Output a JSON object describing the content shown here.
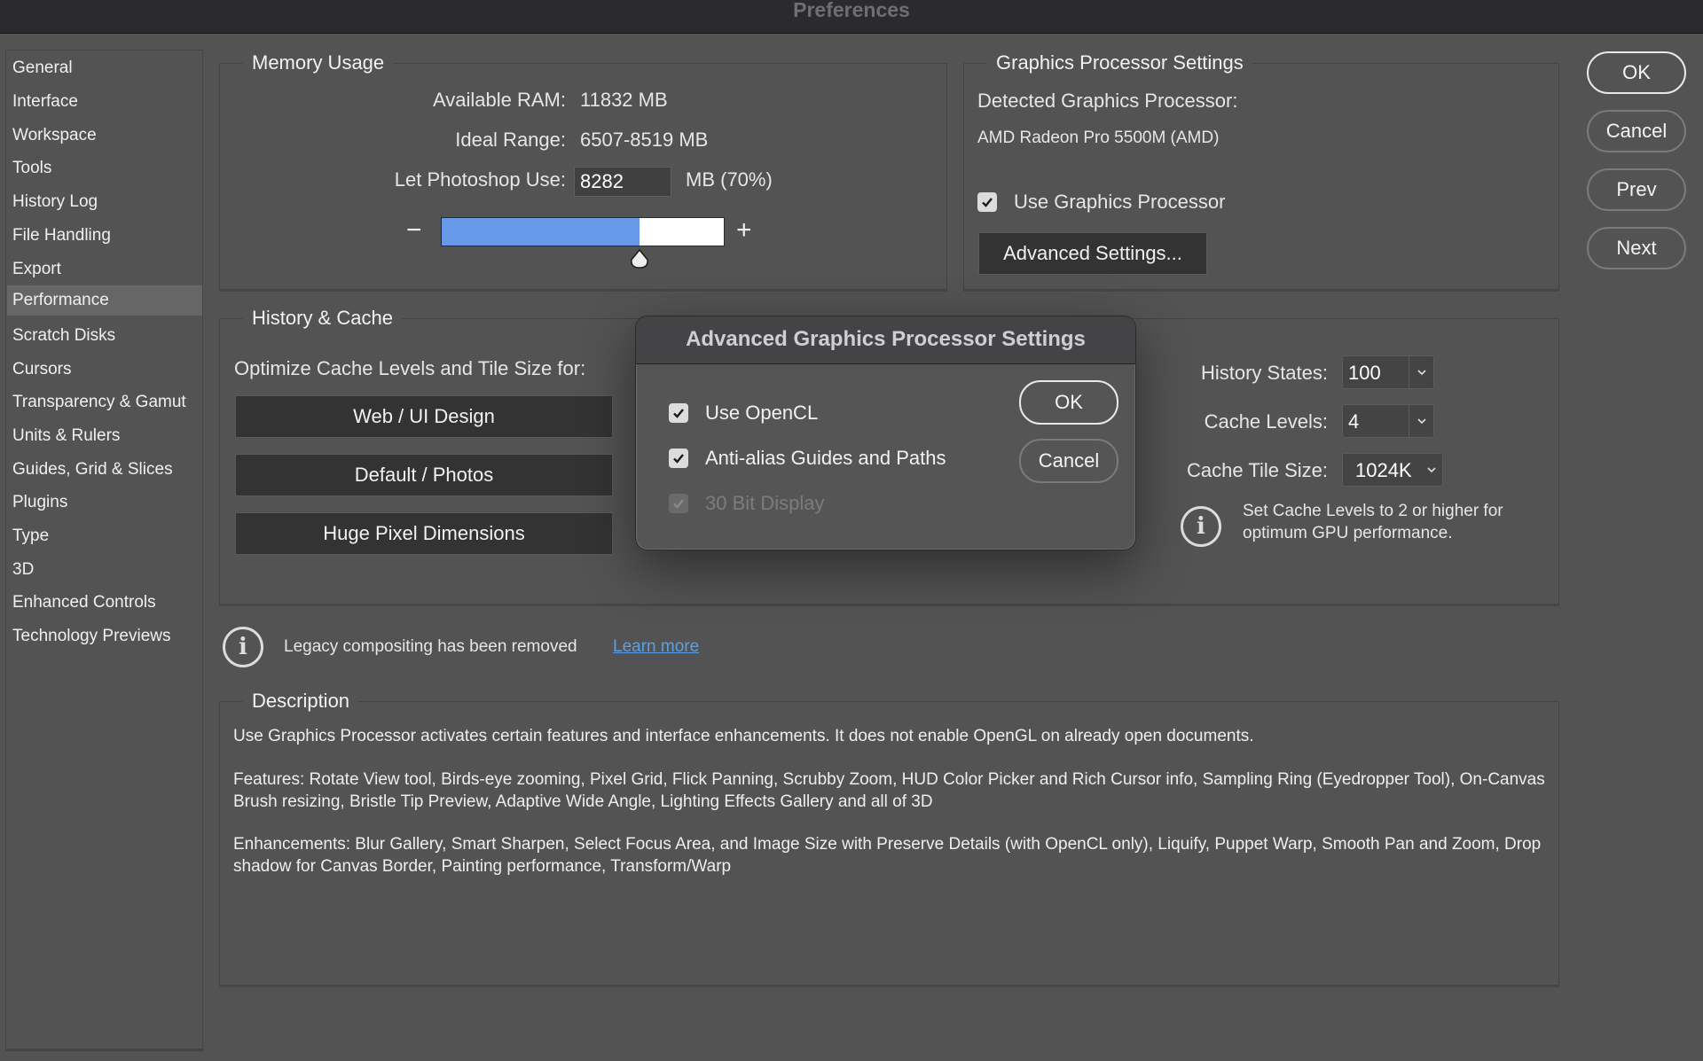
{
  "window": {
    "title": "Preferences"
  },
  "sidebar": {
    "items": [
      {
        "label": "General",
        "active": false
      },
      {
        "label": "Interface",
        "active": false
      },
      {
        "label": "Workspace",
        "active": false
      },
      {
        "label": "Tools",
        "active": false
      },
      {
        "label": "History Log",
        "active": false
      },
      {
        "label": "File Handling",
        "active": false
      },
      {
        "label": "Export",
        "active": false
      },
      {
        "label": "Performance",
        "active": true
      },
      {
        "label": "Scratch Disks",
        "active": false
      },
      {
        "label": "Cursors",
        "active": false
      },
      {
        "label": "Transparency & Gamut",
        "active": false
      },
      {
        "label": "Units & Rulers",
        "active": false
      },
      {
        "label": "Guides, Grid & Slices",
        "active": false
      },
      {
        "label": "Plugins",
        "active": false
      },
      {
        "label": "Type",
        "active": false
      },
      {
        "label": "3D",
        "active": false
      },
      {
        "label": "Enhanced Controls",
        "active": false
      },
      {
        "label": "Technology Previews",
        "active": false
      }
    ]
  },
  "memory": {
    "legend": "Memory Usage",
    "available_label": "Available RAM:",
    "available_value": "11832 MB",
    "ideal_label": "Ideal Range:",
    "ideal_value": "6507-8519 MB",
    "use_label": "Let Photoshop Use:",
    "use_value": "8282",
    "use_unit": "MB (70%)",
    "slider_percent": 70,
    "minus": "−",
    "plus": "+"
  },
  "gpu": {
    "legend": "Graphics Processor Settings",
    "detected_label": "Detected Graphics Processor:",
    "detected_value": "AMD Radeon Pro 5500M (AMD)",
    "use_gpu_label": "Use Graphics Processor",
    "use_gpu_checked": true,
    "advanced_button": "Advanced Settings..."
  },
  "history": {
    "legend": "History & Cache",
    "optimize_label": "Optimize Cache Levels and Tile Size for:",
    "presets": [
      "Web / UI Design",
      "Default / Photos",
      "Huge Pixel Dimensions"
    ],
    "history_states_label": "History States:",
    "history_states_value": "100",
    "cache_levels_label": "Cache Levels:",
    "cache_levels_value": "4",
    "cache_tile_label": "Cache Tile Size:",
    "cache_tile_value": "1024K",
    "gpu_tip": "Set Cache Levels to 2 or higher for optimum GPU performance."
  },
  "notice": {
    "text": "Legacy compositing has been removed",
    "link": "Learn more",
    "link_color": "#5aa0e6"
  },
  "description": {
    "legend": "Description",
    "paragraphs": [
      "Use Graphics Processor activates certain features and interface enhancements. It does not enable OpenGL on already open documents.",
      "Features: Rotate View tool, Birds-eye zooming, Pixel Grid, Flick Panning, Scrubby Zoom, HUD Color Picker and Rich Cursor info, Sampling Ring (Eyedropper Tool), On-Canvas Brush resizing, Bristle Tip Preview, Adaptive Wide Angle, Lighting Effects Gallery and all of 3D",
      "Enhancements: Blur Gallery, Smart Sharpen, Select Focus Area, and Image Size with Preserve Details (with OpenCL only), Liquify, Puppet Warp, Smooth Pan and Zoom, Drop shadow for Canvas Border, Painting performance, Transform/Warp"
    ]
  },
  "actions": {
    "ok": "OK",
    "cancel": "Cancel",
    "prev": "Prev",
    "next": "Next"
  },
  "modal": {
    "title": "Advanced Graphics Processor Settings",
    "options": [
      {
        "label": "Use OpenCL",
        "checked": true,
        "disabled": false
      },
      {
        "label": "Anti-alias Guides and Paths",
        "checked": true,
        "disabled": false
      },
      {
        "label": "30 Bit Display",
        "checked": true,
        "disabled": true
      }
    ],
    "ok": "OK",
    "cancel": "Cancel"
  },
  "colors": {
    "background": "#535353",
    "titlebar": "#2b2a2e",
    "slider_fill": "#6699e8",
    "active_sidebar": "#666666"
  }
}
